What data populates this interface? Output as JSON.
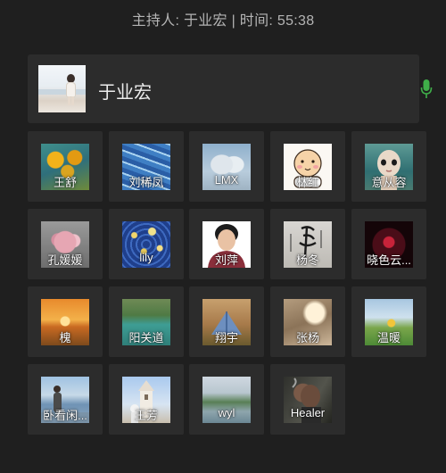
{
  "header": {
    "status": "主持人: 于业宏 | 时间: 55:38"
  },
  "host": {
    "name": "于业宏",
    "mic_color": "#3fae49"
  },
  "participants": [
    {
      "name": "王舒",
      "art": "sunflower",
      "avatar": "sunflower-painting"
    },
    {
      "name": "刘稀凤",
      "art": "blue",
      "avatar": "blue-fish-painting"
    },
    {
      "name": "LMX",
      "art": "statue",
      "avatar": "statues-photo"
    },
    {
      "name": "林红",
      "art": "cartoon",
      "avatar": "cartoon-baby"
    },
    {
      "name": "意从容",
      "art": "face",
      "avatar": "doll-face"
    },
    {
      "name": "孔媛媛",
      "art": "flower",
      "avatar": "pink-flower"
    },
    {
      "name": "lily",
      "art": "night",
      "avatar": "starry-night"
    },
    {
      "name": "刘萍",
      "art": "woman",
      "avatar": "woman-portrait"
    },
    {
      "name": "杨冬",
      "art": "calli",
      "avatar": "calligraphy"
    },
    {
      "name": "晓色云...",
      "art": "red",
      "avatar": "red-heart"
    },
    {
      "name": "槐",
      "art": "sunset",
      "avatar": "sunset"
    },
    {
      "name": "阳关道",
      "art": "lake",
      "avatar": "lake"
    },
    {
      "name": "翔宇",
      "art": "tent",
      "avatar": "tent"
    },
    {
      "name": "张杨",
      "art": "forest",
      "avatar": "forest-light"
    },
    {
      "name": "温暖",
      "art": "field",
      "avatar": "field-sunflower"
    },
    {
      "name": "卧看闲...",
      "art": "pier",
      "avatar": "pier-person"
    },
    {
      "name": "王芳",
      "art": "church",
      "avatar": "church-tower"
    },
    {
      "name": "wyl",
      "art": "river",
      "avatar": "river-view"
    },
    {
      "name": "Healer",
      "art": "smoke",
      "avatar": "smoker-photo"
    }
  ]
}
